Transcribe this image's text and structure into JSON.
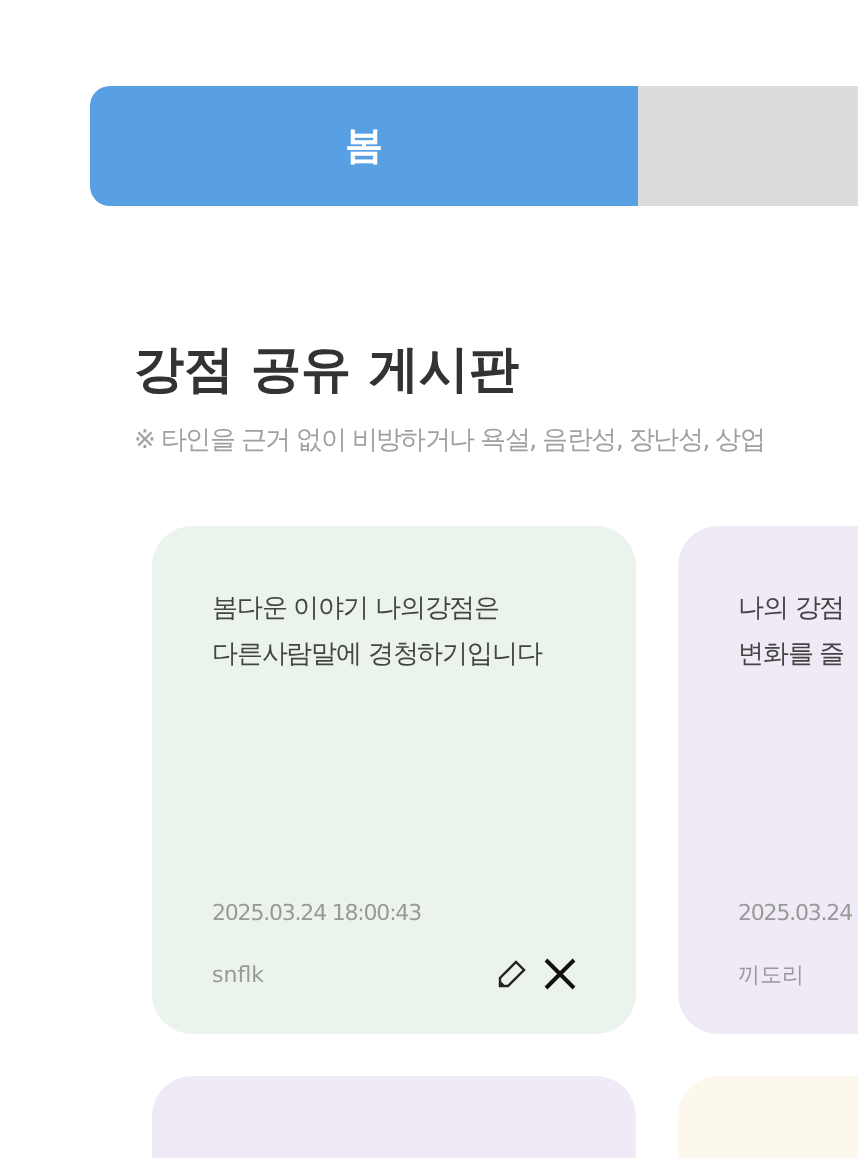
{
  "tabs": [
    {
      "label": "봄",
      "selected": true
    },
    {
      "selected": false
    }
  ],
  "board": {
    "title": "강점 공유 게시판",
    "notice": "※ 타인을 근거 없이 비방하거나 욕설, 음란성, 장난성, 상업"
  },
  "cards": [
    {
      "lines": [
        "봄다운 이야기 나의강점은",
        "다른사람말에 경청하기입니다"
      ],
      "date": "2025.03.24 18:00:43",
      "author": "snflk",
      "editable": true,
      "color": "#ebf4ec"
    },
    {
      "lines": [
        "나의 강점",
        "변화를 즐"
      ],
      "date": "2025.03.24",
      "author": "끼도리",
      "color": "#efeaf5"
    },
    {
      "color": "#efeaf5"
    },
    {
      "color": "#fcf8ee"
    }
  ]
}
